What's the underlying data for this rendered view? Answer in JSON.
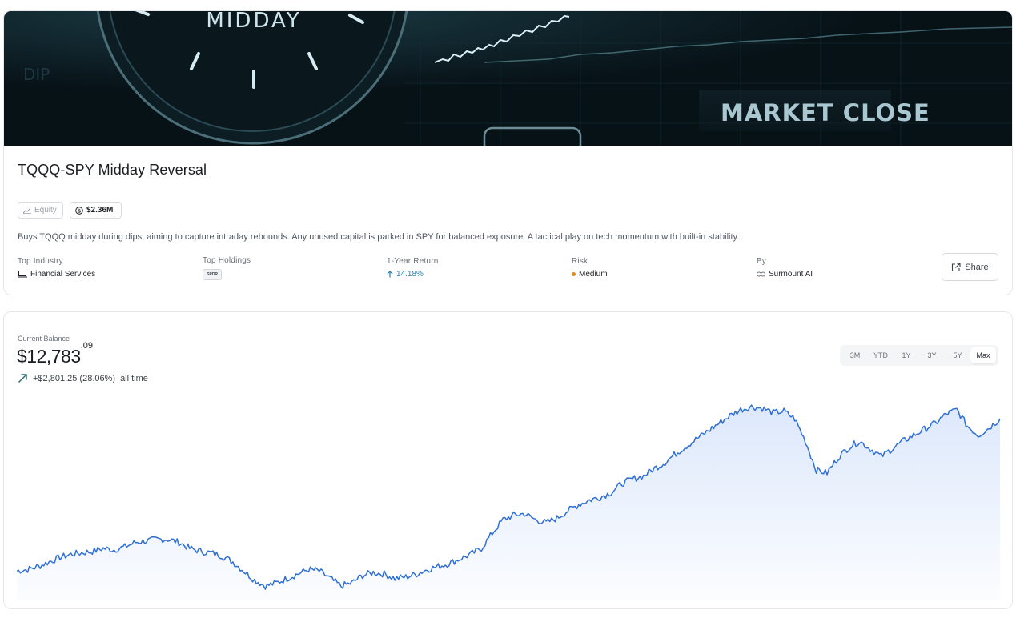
{
  "hero": {
    "clock_text": "MIDDAY",
    "dip_text": "DIP",
    "sign_text": "MARKET CLOSE",
    "colors": {
      "background": "#08161c",
      "accent": "#b9d6df"
    }
  },
  "strategy": {
    "title": "TQQQ-SPY Midday Reversal",
    "badges": {
      "type": "Equity",
      "aum": "$2.36M"
    },
    "description": "Buys TQQQ midday during dips, aiming to capture intraday rebounds. Any unused capital is parked in SPY for balanced exposure. A tactical play on tech momentum with built-in stability.",
    "meta": {
      "industry_label": "Top Industry",
      "industry_value": "Financial Services",
      "holdings_label": "Top Holdings",
      "holding_logo": "SPDR",
      "return_label": "1-Year Return",
      "return_value": "14.18%",
      "risk_label": "Risk",
      "risk_value": "Medium",
      "by_label": "By",
      "by_value": "Surmount AI"
    },
    "share_label": "Share"
  },
  "balance": {
    "label": "Current Balance",
    "whole": "$12,783",
    "cents": ".09",
    "change": "+$2,801.25 (28.06%)",
    "change_suffix": "all time"
  },
  "ranges": {
    "items": [
      "3M",
      "YTD",
      "1Y",
      "3Y",
      "5Y",
      "Max"
    ],
    "active": "Max"
  },
  "colors": {
    "line": "#2f6fd6",
    "fill_top": "#dbe7fb",
    "up": "#2f7fb5",
    "risk_dot": "#e08a1e"
  },
  "chart_data": {
    "type": "area",
    "title": "",
    "xlabel": "",
    "ylabel": "",
    "grid": false,
    "series": [
      {
        "values": [
          10.0,
          10.1,
          10.3,
          10.6,
          10.9,
          11.1,
          11.2,
          11.3,
          11.5,
          11.4,
          11.6,
          11.9,
          12.0,
          12.1,
          12.1,
          11.9,
          11.5,
          11.3,
          11.2,
          11.0,
          10.6,
          10.0,
          9.4,
          9.0,
          9.2,
          9.5,
          9.8,
          10.1,
          10.0,
          9.5,
          9.0,
          9.2,
          9.7,
          9.9,
          9.8,
          9.5,
          9.6,
          9.8,
          10.1,
          10.3,
          10.5,
          10.8,
          11.1,
          11.5,
          12.5,
          13.4,
          13.7,
          13.8,
          13.4,
          13.2,
          13.5,
          14.0,
          14.4,
          14.7,
          14.9,
          15.2,
          15.8,
          16.1,
          16.3,
          16.8,
          17.2,
          17.8,
          18.3,
          18.8,
          19.3,
          19.8,
          20.3,
          20.7,
          20.9,
          20.8,
          20.5,
          20.6,
          20.1,
          18.6,
          16.7,
          16.5,
          17.5,
          18.2,
          18.6,
          18.1,
          17.6,
          18.1,
          18.6,
          19.0,
          19.4,
          19.8,
          20.4,
          20.7,
          19.6,
          19.0,
          19.5,
          20.1
        ]
      }
    ]
  }
}
